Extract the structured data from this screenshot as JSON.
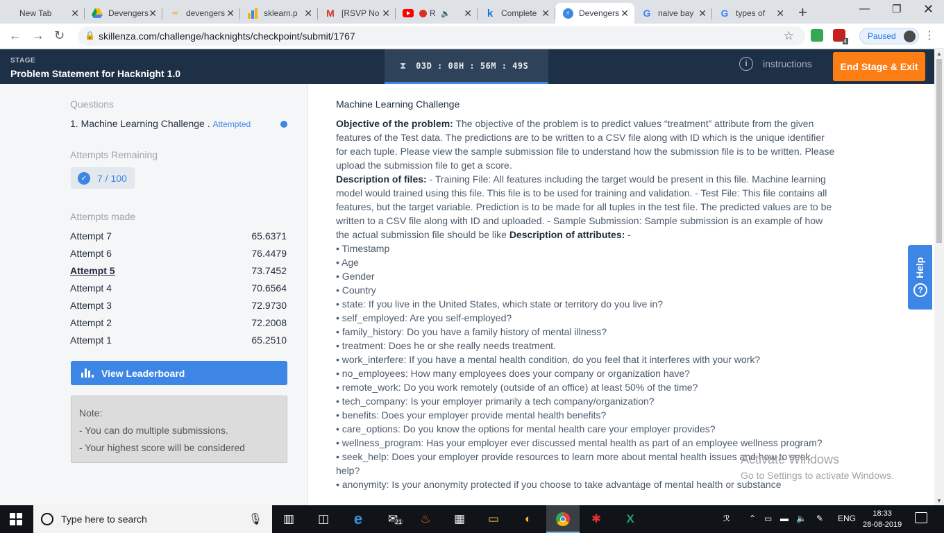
{
  "browser": {
    "tabs": [
      {
        "title": "New Tab",
        "icon": "none",
        "color": "#5f6368"
      },
      {
        "title": "Devengers",
        "icon": "drive-icon",
        "color": "#1fa463"
      },
      {
        "title": "devengers",
        "icon": "infinity-icon",
        "color": "#f5a623"
      },
      {
        "title": "sklearn.p",
        "icon": "chart-icon",
        "color": "#f4b400"
      },
      {
        "title": "[RSVP No",
        "icon": "gmail-icon",
        "color": "#d93025"
      },
      {
        "title": "R",
        "icon": "youtube-icon",
        "color": "#ff0000"
      },
      {
        "title": "Complete",
        "icon": "k-icon",
        "color": "#1a73e8"
      },
      {
        "title": "Devengers",
        "icon": "skillenza-icon",
        "color": "#3d86e5"
      },
      {
        "title": "naive bay",
        "icon": "google-icon",
        "color": "#4285f4"
      },
      {
        "title": "types of",
        "icon": "google-icon",
        "color": "#4285f4"
      }
    ],
    "url": "skillenza.com/challenge/hacknights/checkpoint/submit/1767",
    "profile_label": "Paused",
    "ext_badge": "4"
  },
  "header": {
    "stage_label": "STAGE",
    "stage_title": "Problem Statement for Hacknight 1.0",
    "timer": "03D : 08H : 56M : 49S",
    "instructions": "instructions",
    "end_button": "End Stage & Exit"
  },
  "sidebar": {
    "questions_label": "Questions",
    "question": "1. Machine Learning Challenge .",
    "question_status": "Attempted",
    "attempts_remaining_label": "Attempts Remaining",
    "attempts_remaining": "7 / 100",
    "attempts_made_label": "Attempts made",
    "attempts": [
      {
        "name": "Attempt 7",
        "score": "65.6371"
      },
      {
        "name": "Attempt 6",
        "score": "76.4479"
      },
      {
        "name": "Attempt 5",
        "score": "73.7452"
      },
      {
        "name": "Attempt 4",
        "score": "70.6564"
      },
      {
        "name": "Attempt 3",
        "score": "72.9730"
      },
      {
        "name": "Attempt 2",
        "score": "72.2008"
      },
      {
        "name": "Attempt 1",
        "score": "65.2510"
      }
    ],
    "leaderboard_button": "View Leaderboard",
    "note_title": "Note:",
    "note_lines": [
      "- You can do multiple submissions.",
      "- Your highest score will be considered"
    ]
  },
  "content": {
    "heading": "Machine Learning Challenge",
    "objective_label": "Objective of the problem:",
    "objective_text": " The objective of the problem is to predict values “treatment” attribute from the given features of the Test data. The predictions are to be written to a CSV file along with ID which is the unique identifier for each tuple. Please view the sample submission file to understand how the submission file is to be written. Please upload the submission file to get a score.",
    "files_label": "Description of files:",
    "files_text": " - Training File: All features including the target would be present in this file. Machine learning model would trained using this file. This file is to be used for training and validation. - Test File: This file contains all features, but the target variable. Prediction is to be made for all tuples in the test file. The predicted values are to be written to a CSV file along with ID and uploaded. - Sample Submission: Sample submission is an example of how the actual submission file should be like ",
    "attrs_label": "Description of attributes:",
    "attrs_suffix": " -",
    "attributes": [
      "• Timestamp",
      "• Age",
      "• Gender",
      "• Country",
      "• state: If you live in the United States, which state or territory do you live in?",
      "• self_employed: Are you self-employed?",
      "• family_history: Do you have a family history of mental illness?",
      "• treatment: Does he or she really needs treatment.",
      "• work_interfere: If you have a mental health condition, do you feel that it interferes with your work?",
      "• no_employees: How many employees does your company or organization have?",
      "• remote_work: Do you work remotely (outside of an office) at least 50% of the time?",
      "• tech_company: Is your employer primarily a tech company/organization?",
      "• benefits: Does your employer provide mental health benefits?",
      "• care_options: Do you know the options for mental health care your employer provides?",
      "• wellness_program: Has your employer ever discussed mental health as part of an employee wellness program?",
      "• seek_help: Does your employer provide resources to learn more about mental health issues and how to seek help?",
      "• anonymity: Is your anonymity protected if you choose to take advantage of mental health or substance"
    ]
  },
  "help_label": "Help",
  "watermark": {
    "title": "Activate Windows",
    "subtitle": "Go to Settings to activate Windows."
  },
  "taskbar": {
    "search_placeholder": "Type here to search",
    "mail_badge": "21",
    "language": "ENG",
    "time": "18:33",
    "date": "28-08-2019"
  },
  "colors": {
    "accent": "#3d86e5",
    "header_bg": "#1e3046",
    "end_button": "#fd7e14"
  }
}
